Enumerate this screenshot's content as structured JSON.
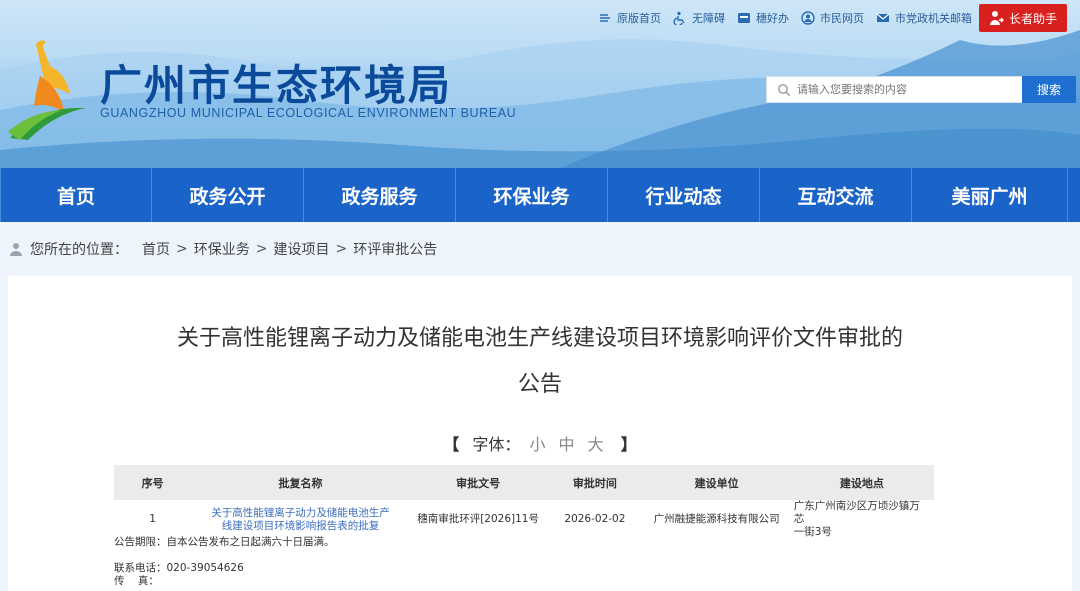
{
  "header": {
    "title": "广州市生态环境局",
    "subtitle": "GUANGZHOU MUNICIPAL ECOLOGICAL ENVIRONMENT BUREAU",
    "top_links": [
      {
        "label": "原版首页",
        "icon": "return-icon"
      },
      {
        "label": "无障碍",
        "icon": "accessibility-icon"
      },
      {
        "label": "穗好办",
        "icon": "app-icon"
      },
      {
        "label": "市民网页",
        "icon": "citizen-icon"
      },
      {
        "label": "市党政机关邮箱",
        "icon": "mail-icon"
      }
    ],
    "elder_button": "长者助手",
    "search_placeholder": "请输入您要搜索的内容",
    "search_button": "搜索"
  },
  "nav": [
    "首页",
    "政务公开",
    "政务服务",
    "环保业务",
    "行业动态",
    "互动交流",
    "美丽广州"
  ],
  "breadcrumb": {
    "label": "您所在的位置：",
    "items": [
      "首页",
      "环保业务",
      "建设项目",
      "环评审批公告"
    ],
    "separator": ">"
  },
  "article": {
    "title_line1": "关于高性能锂离子动力及储能电池生产线建设项目环境影响评价文件审批的",
    "title_line2": "公告",
    "font_label": "字体：",
    "font_open": "【",
    "font_close": "】",
    "font_options": [
      "小",
      "中",
      "大"
    ]
  },
  "table": {
    "headers": [
      "序号",
      "批复名称",
      "审批文号",
      "审批时间",
      "建设单位",
      "建设地点"
    ],
    "rows": [
      {
        "no": "1",
        "name_line1": "关于高性能锂离子动力及储能电池生产",
        "name_line2": "线建设项目环境影响报告表的批复",
        "doc_no": "穗南审批环评[2026]11号",
        "date": "2026-02-02",
        "unit": "广州融捷能源科技有限公司",
        "loc_line1": "广东广州南沙区万顷沙镇万芯",
        "loc_line2": "一街3号"
      }
    ]
  },
  "notes": {
    "period": "公告期限：自本公告发布之日起满六十日届满。",
    "phone": "联系电话：020-39054626",
    "fax": "传    真："
  },
  "colors": {
    "nav_bg": "#1a63c8",
    "title_blue": "#0b4a9a",
    "elder_red": "#d8201e",
    "search_blue": "#1f6fd1",
    "link_blue": "#3b6dbe"
  }
}
